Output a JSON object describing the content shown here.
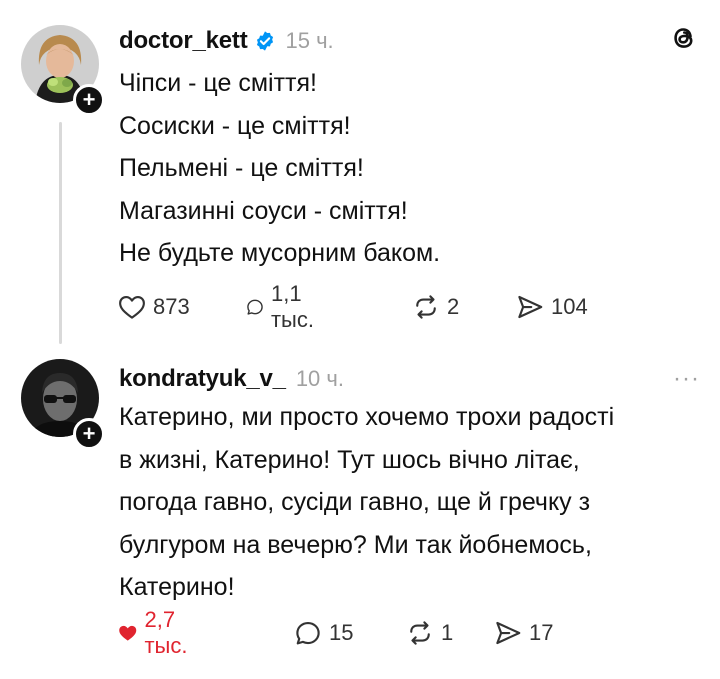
{
  "posts": [
    {
      "author": "doctor_kett",
      "verified": true,
      "time": "15 ч.",
      "lines": [
        "Чіпси - це сміття!",
        "Сосиски - це сміття!",
        "Пельмені - це сміття!",
        "Магазинні соуси - сміття!",
        "Не будьте мусорним баком."
      ],
      "likes": "873",
      "replies": "1,1 тыс.",
      "reposts": "2",
      "shares": "104",
      "liked": false
    },
    {
      "author": "kondratyuk_v_",
      "verified": false,
      "time": "10 ч.",
      "lines": [
        "Катерино, ми просто хочемо трохи радості",
        "в жизні, Катерино! Тут шось вічно літає,",
        "погода гавно, сусіди гавно, ще й гречку з",
        "булгуром на вечерю? Ми так йобнемось,",
        "Катерино!"
      ],
      "likes": "2,7 тыс.",
      "replies": "15",
      "reposts": "1",
      "shares": "17",
      "liked": true
    }
  ],
  "icons": {
    "follow_badge": "+",
    "more": "···",
    "app_logo": "threads-logo-icon",
    "like": "heart-icon",
    "reply": "comment-icon",
    "repost": "repost-icon",
    "share": "share-icon",
    "verified": "verified-badge-icon"
  },
  "colors": {
    "liked_heart": "#e0242f",
    "verified_badge": "#0095f6",
    "muted_text": "#a0a0a0",
    "thread_line": "#d9d9d9"
  }
}
